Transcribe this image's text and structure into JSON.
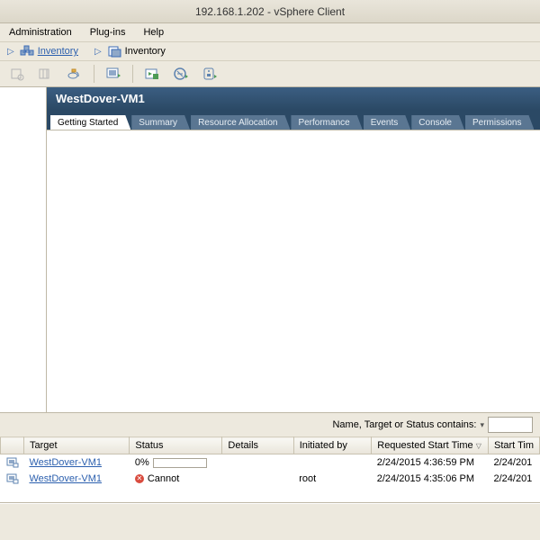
{
  "title": "192.168.1.202 - vSphere Client",
  "menu": {
    "admin": "Administration",
    "plugins": "Plug-ins",
    "help": "Help"
  },
  "nav": {
    "inventory1": "Inventory",
    "inventory2": "Inventory"
  },
  "vm": {
    "name": "WestDover-VM1"
  },
  "tabs": {
    "getting_started": "Getting Started",
    "summary": "Summary",
    "resource_alloc": "Resource Allocation",
    "performance": "Performance",
    "events": "Events",
    "console": "Console",
    "permissions": "Permissions"
  },
  "filter": {
    "label": "Name, Target or Status contains:",
    "chev": "▾"
  },
  "columns": {
    "target": "Target",
    "status": "Status",
    "details": "Details",
    "initiated_by": "Initiated by",
    "requested_start": "Requested Start Time",
    "start_time": "Start Tim"
  },
  "tasks": [
    {
      "target": "WestDover-VM1",
      "status_type": "progress",
      "status_text": "0%",
      "details": "",
      "initiated_by": "",
      "requested_start": "2/24/2015 4:36:59 PM",
      "start_time": "2/24/201"
    },
    {
      "target": "WestDover-VM1",
      "status_type": "error",
      "status_text": "Cannot",
      "details": "",
      "initiated_by": "root",
      "requested_start": "2/24/2015 4:35:06 PM",
      "start_time": "2/24/201"
    }
  ]
}
